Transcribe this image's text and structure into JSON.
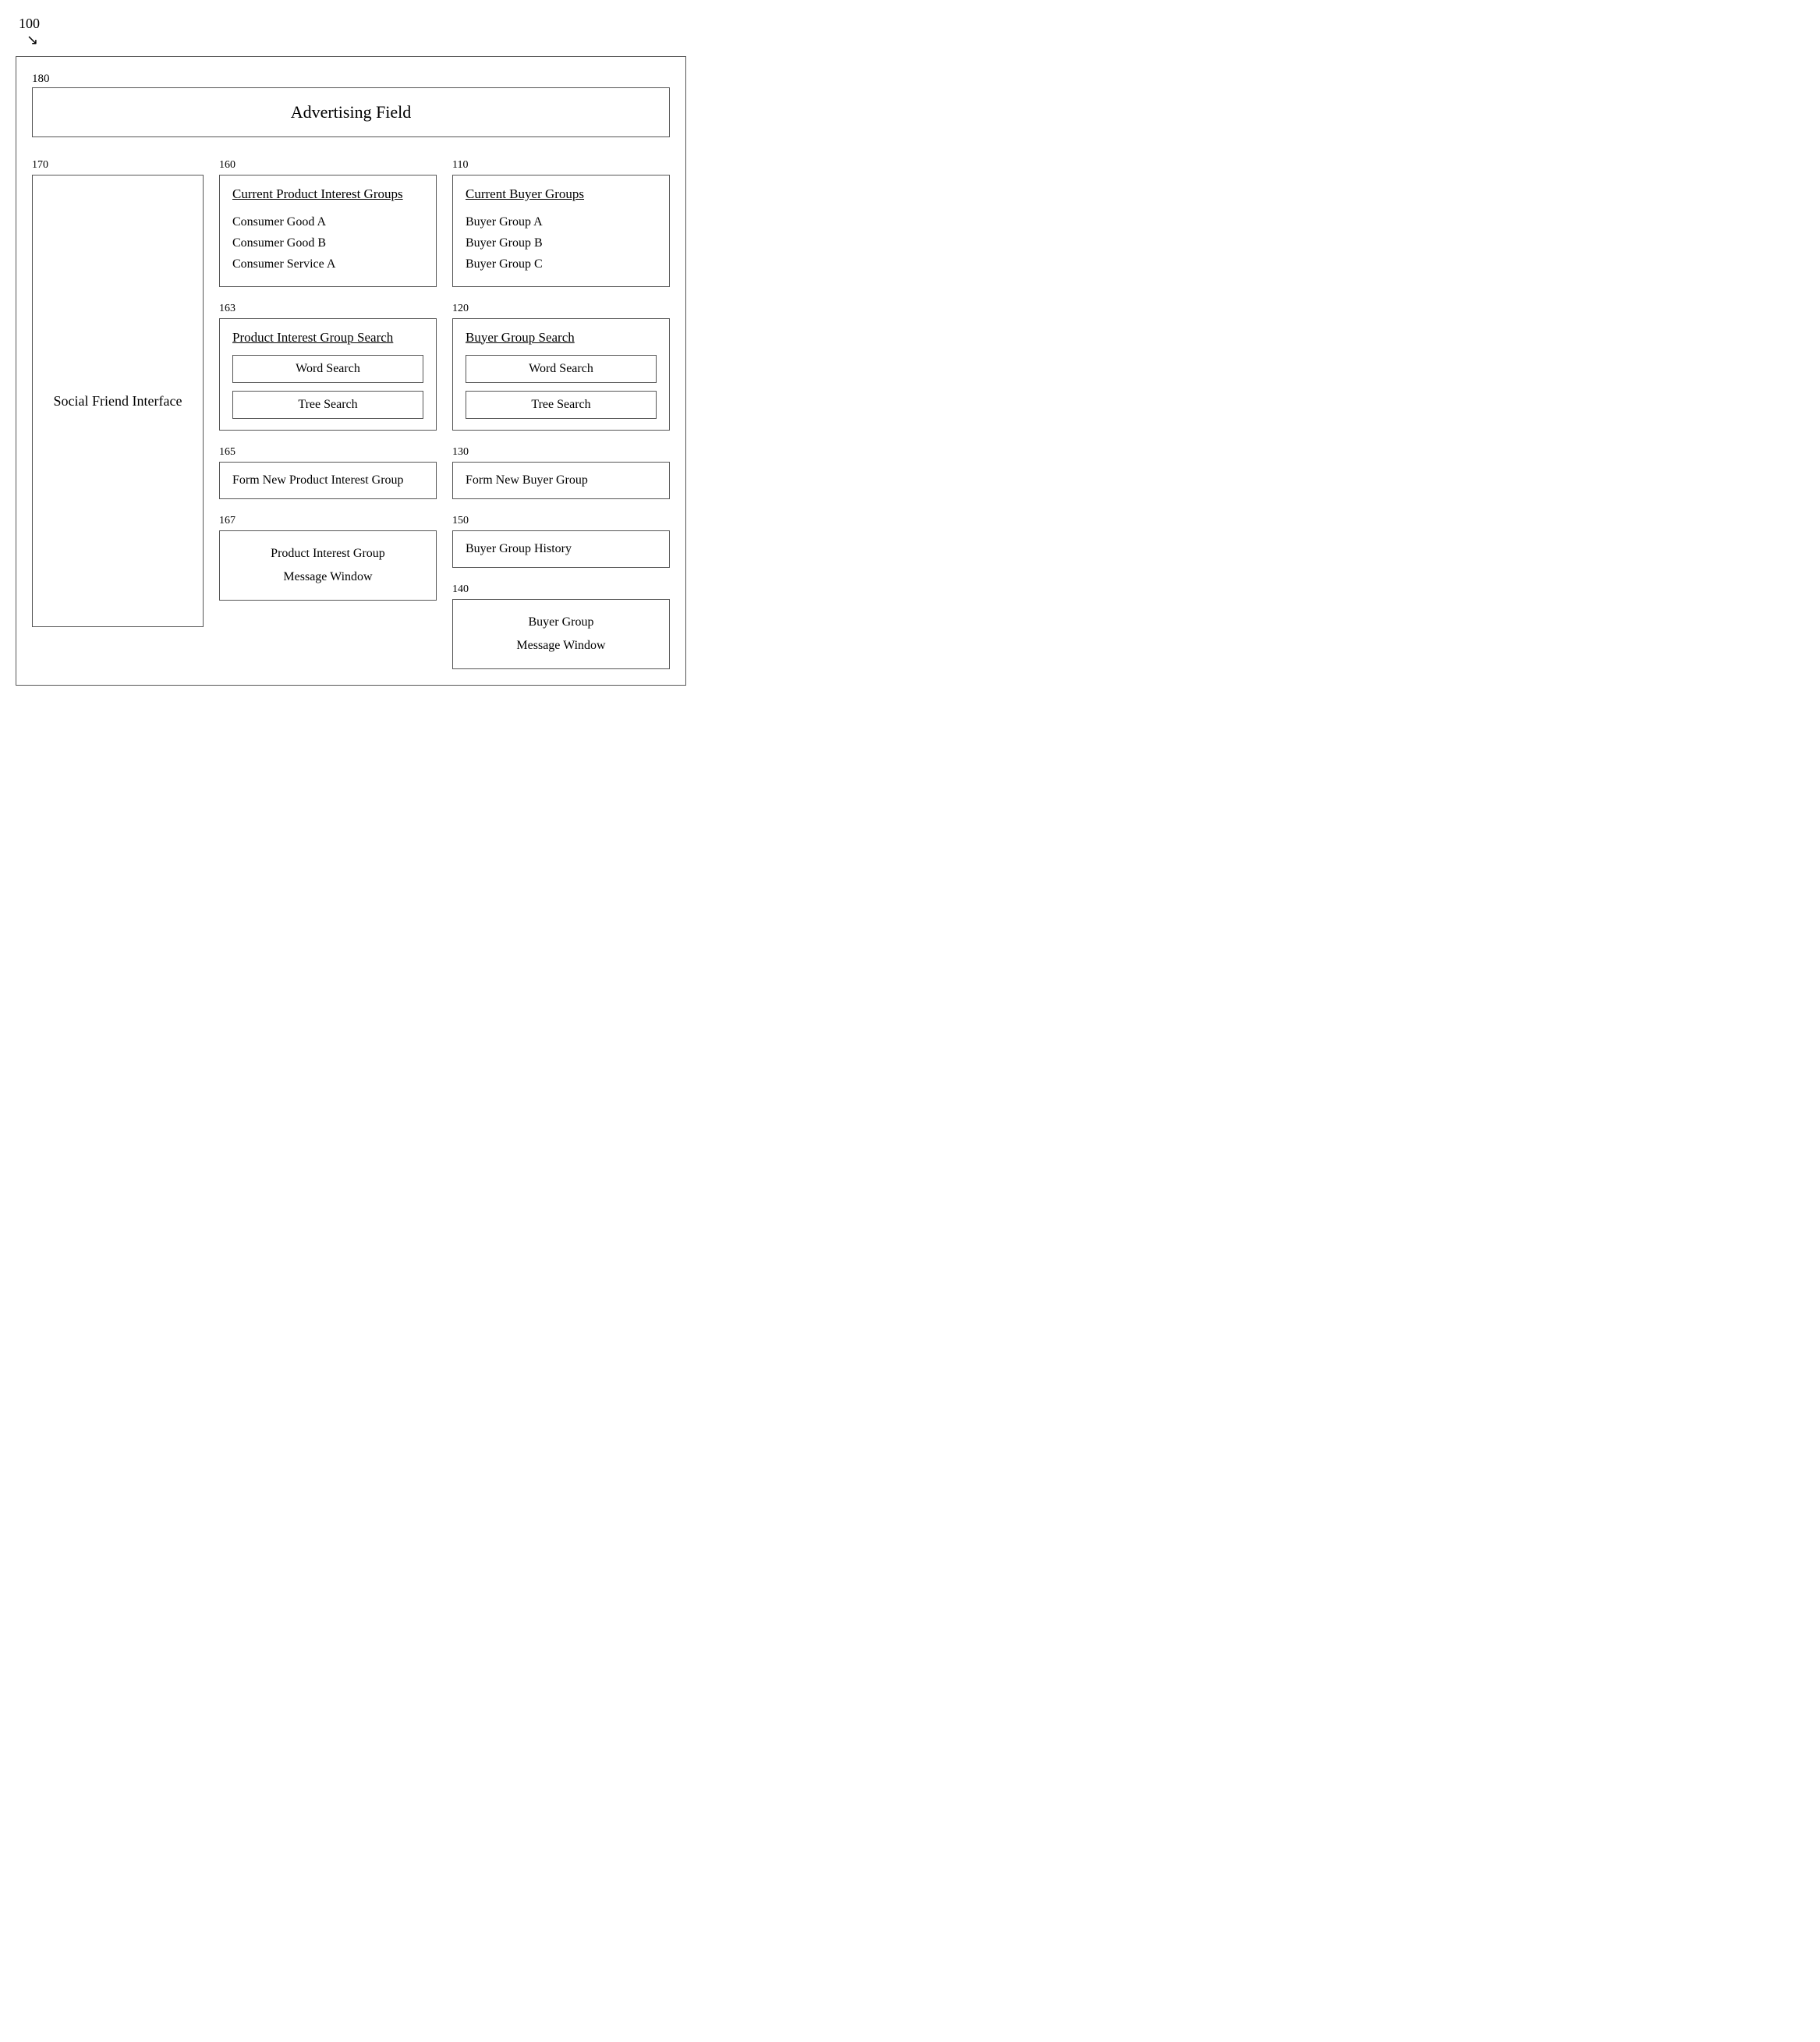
{
  "diagram": {
    "main_label": "100",
    "advertising_ref": "180",
    "advertising_title": "Advertising Field",
    "social_friend_ref": "170",
    "social_friend_label": "Social Friend Interface",
    "product_interest_column": {
      "current_groups": {
        "ref": "160",
        "title": "Current Product Interest Groups",
        "items": [
          "Consumer Good A",
          "Consumer Good B",
          "Consumer Service A"
        ]
      },
      "search": {
        "ref": "163",
        "title": "Product Interest Group Search",
        "word_search": "Word Search",
        "tree_search": "Tree Search"
      },
      "form_new": {
        "ref": "165",
        "label": "Form New Product Interest Group"
      },
      "message_window": {
        "ref": "167",
        "line1": "Product Interest Group",
        "line2": "Message Window"
      }
    },
    "buyer_group_column": {
      "current_groups": {
        "ref": "110",
        "title": "Current Buyer Groups",
        "items": [
          "Buyer Group A",
          "Buyer Group B",
          "Buyer Group C"
        ]
      },
      "search": {
        "ref": "120",
        "title": "Buyer Group Search",
        "word_search": "Word Search",
        "tree_search": "Tree Search"
      },
      "form_new": {
        "ref": "130",
        "label": "Form New Buyer Group"
      },
      "history": {
        "ref": "150",
        "label": "Buyer Group History"
      },
      "message_window": {
        "ref": "140",
        "line1": "Buyer Group",
        "line2": "Message Window"
      }
    }
  }
}
